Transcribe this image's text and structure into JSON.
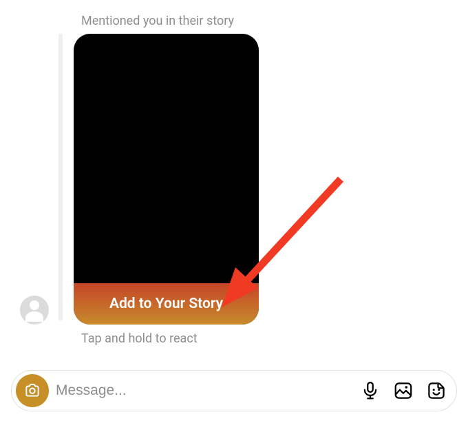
{
  "mention_label": "Mentioned you in their story",
  "add_to_story_label": "Add to Your Story",
  "react_label": "Tap and hold to react",
  "composer": {
    "placeholder": "Message..."
  },
  "colors": {
    "gradient_top": "#c54427",
    "gradient_bottom": "#c78b2c",
    "camera_bg": "#c78f28",
    "arrow": "#f03a24"
  }
}
